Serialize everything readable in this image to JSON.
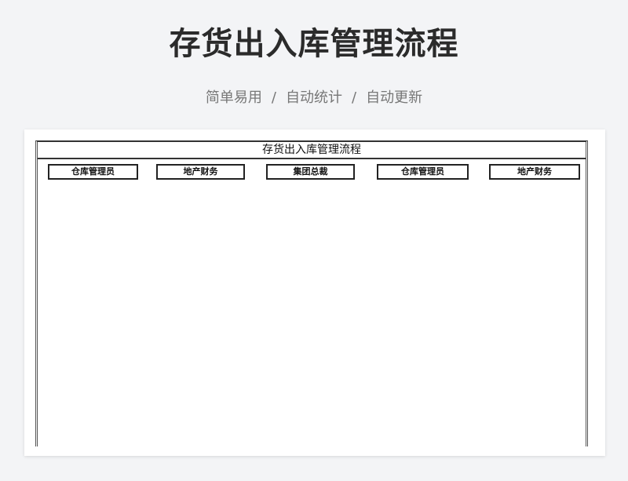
{
  "header": {
    "title": "存货出入库管理流程",
    "subtitle_parts": [
      "简单易用",
      "自动统计",
      "自动更新"
    ],
    "separator": "/"
  },
  "sheet": {
    "title": "存货出入库管理流程",
    "lanes": [
      "仓库管理员",
      "地产财务",
      "集团总裁",
      "仓库管理员",
      "地产财务"
    ]
  }
}
